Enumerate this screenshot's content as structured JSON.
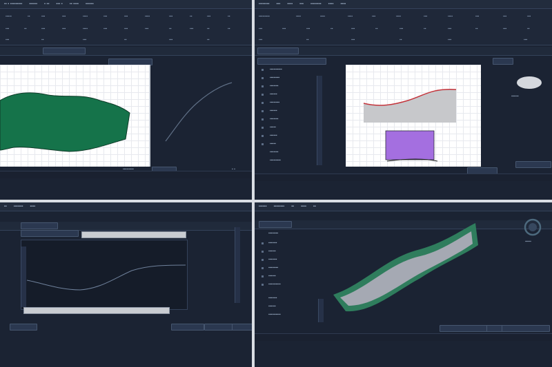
{
  "colors": {
    "background": "#1b2333",
    "panel": "#222c3d",
    "border": "#34425a",
    "plot_fill_green": "#15734a",
    "plot_fill_grey": "#c7c8cb",
    "curve_red": "#c4343b",
    "swatch_purple": "#a46fe0",
    "surface_band_green": "#3d8b6a",
    "surface_band_grey": "#a5a9b3",
    "gauge_ring": "#4d6a7e"
  },
  "icons": {
    "window_controls": "window-control-icons",
    "list_bullets": "square-bullet-icon",
    "gauge": "circular-gauge-icon"
  },
  "panes": {
    "top_left": {
      "name": "analysis-window-top-left"
    },
    "top_right": {
      "name": "analysis-window-top-right"
    },
    "bottom_left": {
      "name": "analysis-window-bottom-left"
    },
    "bottom_right": {
      "name": "analysis-window-bottom-right"
    }
  }
}
